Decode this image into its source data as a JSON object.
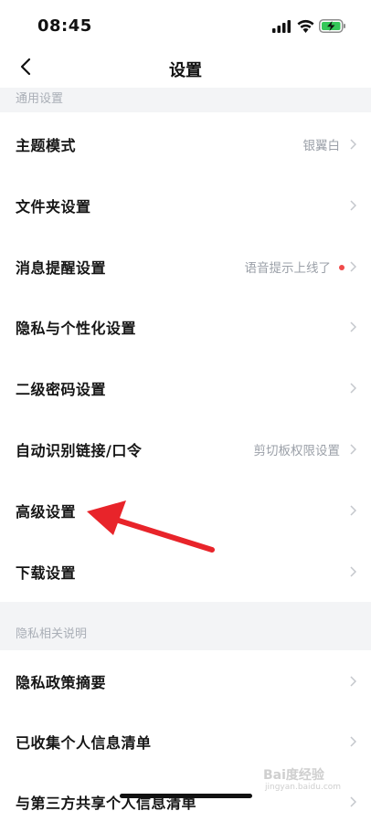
{
  "status_bar": {
    "time": "08:45"
  },
  "nav": {
    "title": "设置"
  },
  "sections": {
    "general_header": "通用设置",
    "privacy_header": "隐私相关说明"
  },
  "rows": [
    {
      "label": "主题模式",
      "value": "银翼白"
    },
    {
      "label": "文件夹设置",
      "value": ""
    },
    {
      "label": "消息提醒设置",
      "value": "语音提示上线了"
    },
    {
      "label": "隐私与个性化设置",
      "value": ""
    },
    {
      "label": "二级密码设置",
      "value": ""
    },
    {
      "label": "自动识别链接/口令",
      "value": "剪切板权限设置"
    },
    {
      "label": "高级设置",
      "value": ""
    },
    {
      "label": "下载设置",
      "value": ""
    },
    {
      "label": "隐私政策摘要",
      "value": ""
    },
    {
      "label": "已收集个人信息清单",
      "value": ""
    },
    {
      "label": "与第三方共享个人信息清单",
      "value": ""
    }
  ],
  "watermark": {
    "brand": "Bai度经验",
    "url": "jingyan.baidu.com"
  },
  "colors": {
    "annotation_arrow": "#e8242a",
    "notification_dot": "#f04a4a",
    "section_bg": "#f3f4f6"
  }
}
